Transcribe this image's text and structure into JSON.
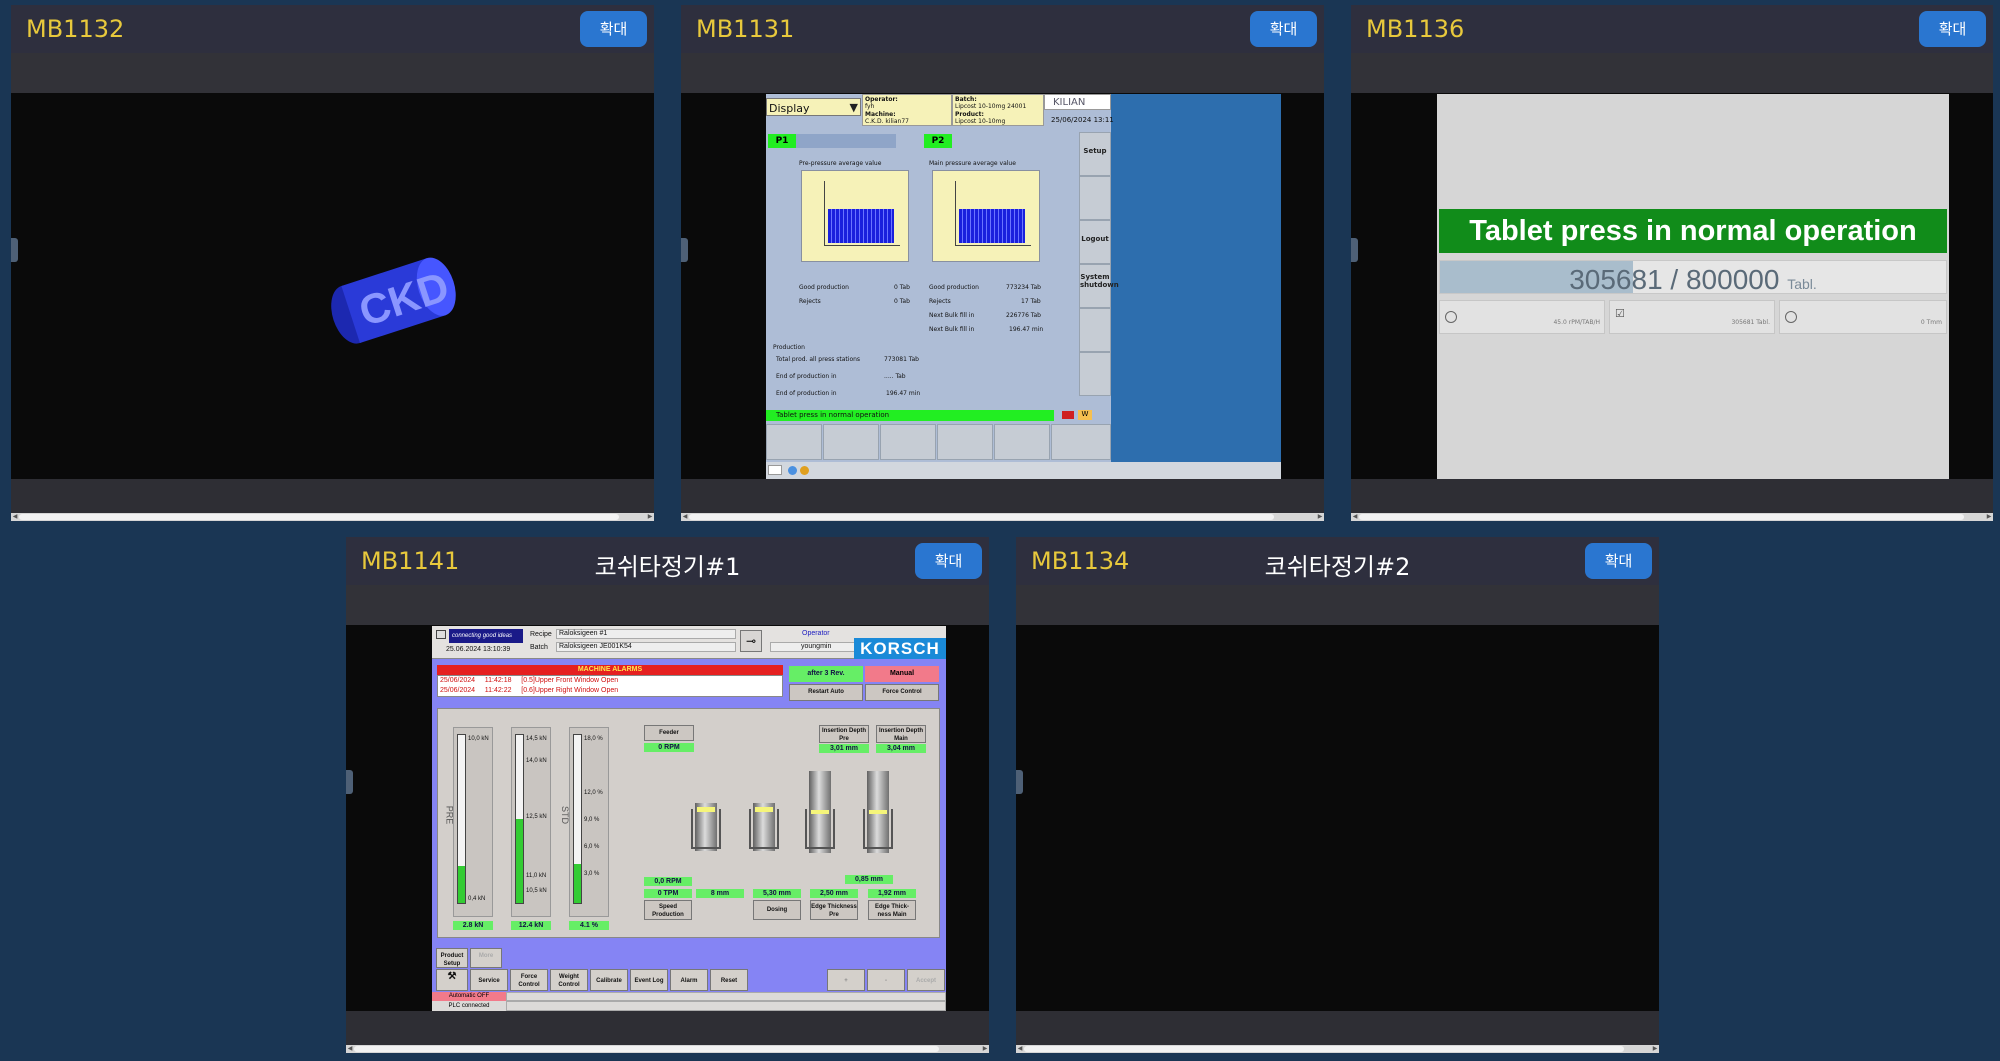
{
  "expand_label": "확대",
  "panels": [
    {
      "id": "MB1132",
      "title": ""
    },
    {
      "id": "MB1131",
      "title": ""
    },
    {
      "id": "MB1136",
      "title": ""
    },
    {
      "id": "MB1141",
      "title": "코쉬타정기#1"
    },
    {
      "id": "MB1134",
      "title": "코쉬타정기#2"
    }
  ],
  "ckd": {
    "logo_text": "CKD",
    "color": "#2a3ad8"
  },
  "kilian": {
    "display": "Display",
    "brand": "KILIAN",
    "operator_label": "Operator:",
    "operator": "fyh",
    "machine_label": "Machine:",
    "machine": "C.K.D. kilian77",
    "batch_label": "Batch:",
    "batch": "Lipcost 10-10mg 24001",
    "product_label": "Product:",
    "product": "Lipcost 10-10mg",
    "datetime": "25/06/2024 13:11",
    "p1": "P1",
    "p2": "P2",
    "pre_title": "Pre-pressure average value",
    "main_title": "Main pressure average value",
    "left_stats": [
      {
        "label": "Good production",
        "value": "0 Tab"
      },
      {
        "label": "Rejects",
        "value": "0 Tab"
      }
    ],
    "right_stats": [
      {
        "label": "Good production",
        "value": "773234 Tab"
      },
      {
        "label": "Rejects",
        "value": "17 Tab"
      },
      {
        "label": "Next Bulk fill in",
        "value": "226776 Tab"
      },
      {
        "label": "Next Bulk fill in",
        "value": "196.47 min"
      }
    ],
    "production_label": "Production",
    "prod_rows": [
      {
        "label": "Total prod. all press stations",
        "value": "773081 Tab"
      },
      {
        "label": "End of production in",
        "value": "..... Tab"
      },
      {
        "label": "End of production in",
        "value": "196.47 min"
      }
    ],
    "side": [
      "Setup",
      "",
      "Logout",
      "System shutdown",
      "",
      ""
    ],
    "status": "Tablet press in normal operation",
    "status_code": "W"
  },
  "gea": {
    "banner": "Tablet press in normal operation",
    "count": "305681 / 800000",
    "unit": "Tabl.",
    "progress": 0.382,
    "boxes": [
      "45.0 rPM/TAB/H",
      "305681 Tabl.",
      "0 Tmm"
    ]
  },
  "korsch": {
    "connect": "connecting good ideas",
    "datetime": "25.06.2024 13:10:39",
    "recipe_label": "Recipe",
    "recipe": "Raloksigeen #1",
    "batch_label": "Batch",
    "batch": "Raloksigeen JE001K54",
    "operator_label": "Operator",
    "operator": "youngmin",
    "brand": "KORSCH",
    "alarms_title": "MACHINE ALARMS",
    "alarms": [
      {
        "date": "25/06/2024",
        "time": "11:42:18",
        "code": "[0.5]",
        "msg": "Upper Front Window Open"
      },
      {
        "date": "25/06/2024",
        "time": "11:42:22",
        "code": "[0.6]",
        "msg": "Upper Right Window Open"
      }
    ],
    "after_rev": "after 3 Rev.",
    "manual": "Manual",
    "restart_auto": "Restart Auto",
    "force_control": "Force Control",
    "gauges": [
      {
        "letters": "PRE",
        "top_label": "10,0 kN",
        "low_label": "0,4 kN",
        "mid_labels": [],
        "value": "2.8 kN",
        "level": 0.22
      },
      {
        "letters": "",
        "top_label": "14,5 kN",
        "low_label": "10,5 kN",
        "mid_labels": [
          "14,0 kN",
          "12,5 kN",
          "11,0 kN"
        ],
        "value": "12.4 kN",
        "level": 0.5
      },
      {
        "letters": "STD",
        "top_label": "18,0 %",
        "low_label": "3,0 %",
        "mid_labels": [
          "12,0 %",
          "9,0 %",
          "6,0 %"
        ],
        "value": "4.1 %",
        "level": 0.23
      }
    ],
    "feeder": "Feeder",
    "feeder_rpm": "0 RPM",
    "insertion_pre": "Insertion Depth Pre",
    "insertion_pre_val": "3,01 mm",
    "insertion_main": "Insertion Depth Main",
    "insertion_main_val": "3,04 mm",
    "speed_rpm": "0,0 RPM",
    "speed_tpm": "0 TPM",
    "val_8mm": "8 mm",
    "dosing_val": "5,30 mm",
    "edge_pre_val": "2,50 mm",
    "edge_main_val": "1,92 mm",
    "edge_top_val": "0,85 mm",
    "speed_production": "Speed Production",
    "dosing": "Dosing",
    "edge_pre": "Edge Thickness Pre",
    "edge_main": "Edge Thick-ness Main",
    "product_setup": "Product Setup",
    "more": "More",
    "buttons": [
      "Service",
      "Force Control",
      "Weight Control",
      "Calibrate",
      "Event Log",
      "Alarm",
      "Reset"
    ],
    "plus": "+",
    "minus": "-",
    "accept": "Accept",
    "auto_off": "Automatic OFF",
    "plc": "PLC connected"
  }
}
